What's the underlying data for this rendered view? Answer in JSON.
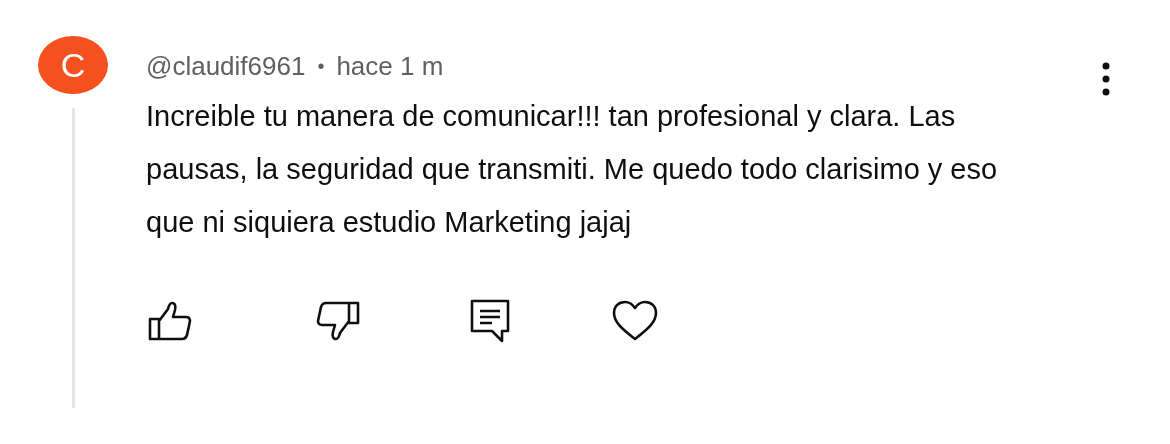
{
  "comment": {
    "avatar_letter": "C",
    "author": "@claudif6961",
    "separator": "•",
    "time": "hace 1 m",
    "text": "Increible tu manera de comunicar!!! tan profesional y clara. Las pausas, la seguridad que transmiti. Me quedo todo clarisimo y eso que ni siquiera estudio Marketing jajaj"
  }
}
